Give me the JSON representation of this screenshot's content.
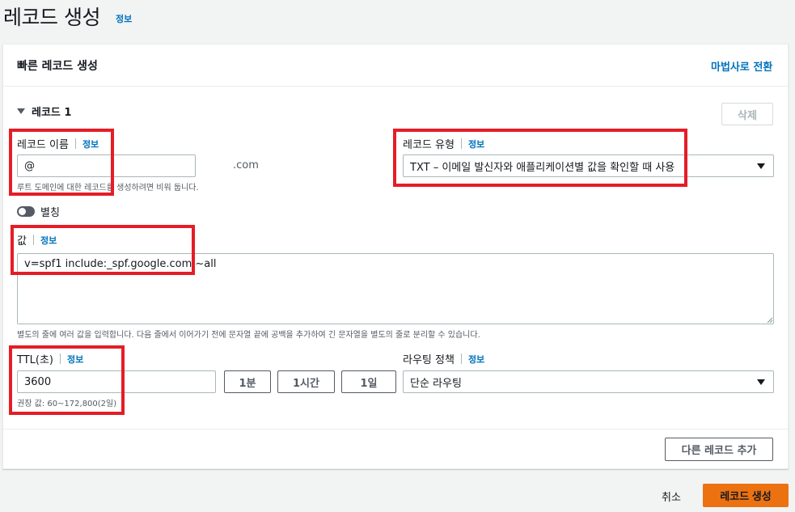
{
  "page": {
    "title": "레코드 생성",
    "title_info": "정보"
  },
  "card": {
    "title": "빠른 레코드 생성",
    "wizard_link": "마법사로 전환",
    "record_label": "레코드 1",
    "delete_label": "삭제"
  },
  "record_name": {
    "label": "레코드 이름",
    "info": "정보",
    "placeholder": "@",
    "domain_suffix": ".com",
    "hint": "루트 도메인에 대한 레코드를 생성하려면 비워 둡니다."
  },
  "record_type": {
    "label": "레코드 유형",
    "info": "정보",
    "selected": "TXT – 이메일 발신자와 애플리케이션별 값을 확인할 때 사용"
  },
  "alias": {
    "label": "별칭"
  },
  "value": {
    "label": "값",
    "info": "정보",
    "content": "v=spf1 include:_spf.google.com ~all",
    "hint": "별도의 줄에 여러 값을 입력합니다. 다음 줄에서 이어가기 전에 문자열 끝에 공백을 추가하여 긴 문자열을 별도의 줄로 분리할 수 있습니다."
  },
  "ttl": {
    "label": "TTL(초)",
    "info": "정보",
    "value": "3600",
    "btn_1m": "1분",
    "btn_1h": "1시간",
    "btn_1d": "1일",
    "hint": "권장 값: 60~172,800(2일)"
  },
  "routing": {
    "label": "라우팅 정책",
    "info": "정보",
    "selected": "단순 라우팅"
  },
  "footer": {
    "add_record": "다른 레코드 추가",
    "cancel": "취소",
    "create": "레코드 생성"
  },
  "colors": {
    "accent": "#0073bb",
    "primary_button": "#ec7211",
    "annotation": "#e41d27"
  }
}
